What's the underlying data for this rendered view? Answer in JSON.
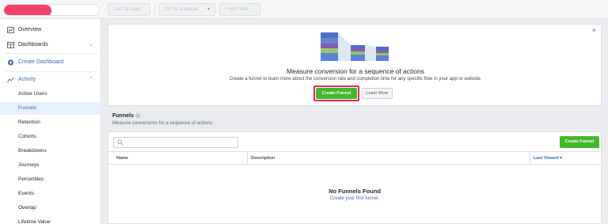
{
  "topbar": {
    "date_range": "Last 28 days",
    "people_filter": "100 % of people",
    "add_filter": "Add Filter"
  },
  "sidebar": {
    "overview": "Overview",
    "dashboards": "Dashboards",
    "create_dashboard": "Create Dashboard",
    "activity": "Activity",
    "items": [
      "Active Users",
      "Funnels",
      "Retention",
      "Cohorts",
      "Breakdowns",
      "Journeys",
      "Percentiles",
      "Events",
      "Overlap",
      "Lifetime Value"
    ]
  },
  "hero": {
    "title": "Measure conversion for a sequence of actions",
    "description": "Create a funnel to learn more about the conversion rate and completion time for any specific flow in your app or website.",
    "create_button": "Create Funnel",
    "learn_button": "Learn More",
    "close": "×"
  },
  "funnels": {
    "title": "Funnels",
    "info": "i",
    "description": "Measure conversions for a sequence of actions.",
    "search_placeholder": "",
    "create_button": "Create Funnel",
    "columns": {
      "name": "Name",
      "description": "Description",
      "last_viewed": "Last Viewed ▾"
    },
    "empty_title": "No Funnels Found",
    "empty_link": "Create your first funnel."
  },
  "colors": {
    "accent": "#4267b2",
    "green": "#42b72a",
    "highlight": "#e2245d",
    "brand_pill": "#f0426a"
  }
}
